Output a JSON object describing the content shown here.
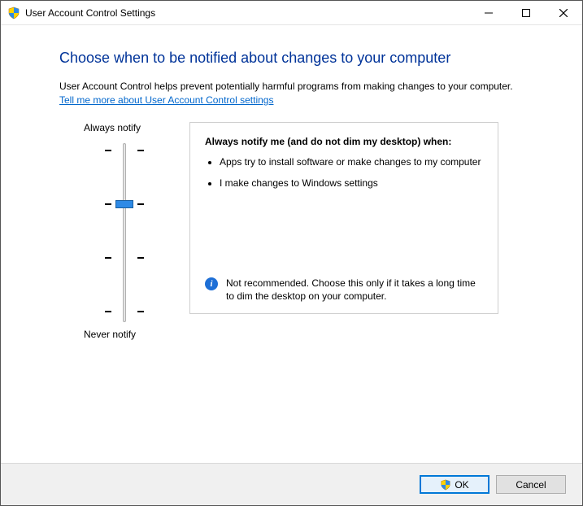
{
  "window": {
    "title": "User Account Control Settings"
  },
  "heading": "Choose when to be notified about changes to your computer",
  "description": "User Account Control helps prevent potentially harmful programs from making changes to your computer.",
  "link": "Tell me more about User Account Control settings",
  "slider": {
    "top_label": "Always notify",
    "bottom_label": "Never notify",
    "levels": 4,
    "current_level": 2
  },
  "panel": {
    "title": "Always notify me (and do not dim my desktop) when:",
    "bullets": [
      "Apps try to install software or make changes to my computer",
      "I make changes to Windows settings"
    ],
    "note": "Not recommended. Choose this only if it takes a long time to dim the desktop on your computer."
  },
  "buttons": {
    "ok": "OK",
    "cancel": "Cancel"
  }
}
